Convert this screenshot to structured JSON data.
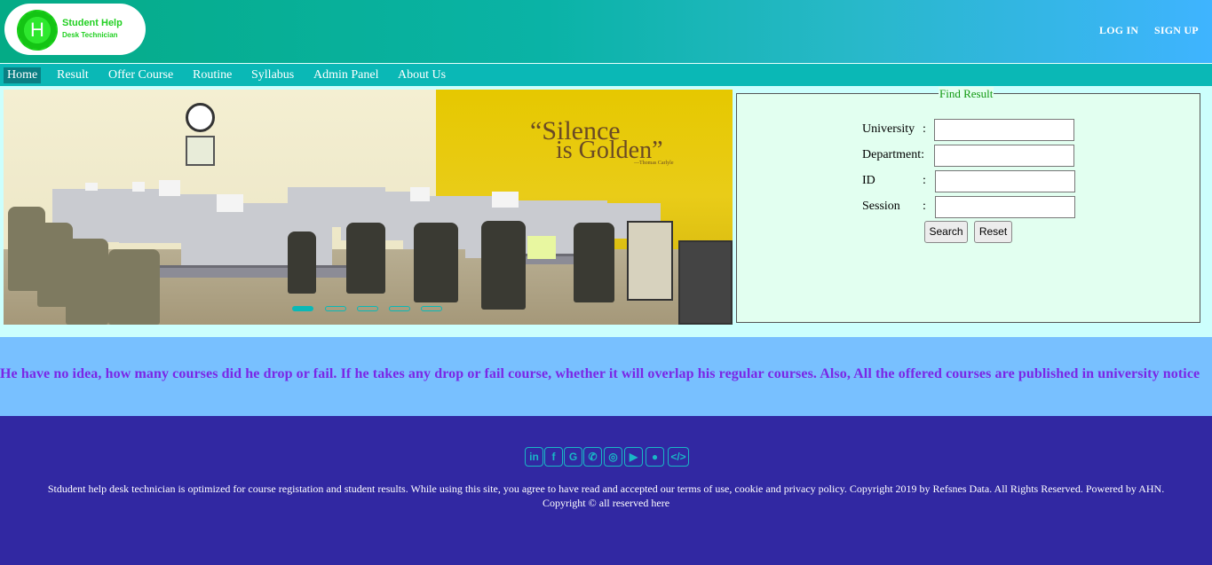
{
  "header": {
    "logo_letter": "H",
    "logo_line1": "Student Help",
    "logo_line2": "Desk Technician",
    "login_label": "LOG IN",
    "signup_label": "SIGN UP"
  },
  "nav": {
    "items": [
      {
        "label": "Home",
        "active": true
      },
      {
        "label": "Result"
      },
      {
        "label": "Offer Course"
      },
      {
        "label": "Routine"
      },
      {
        "label": "Syllabus"
      },
      {
        "label": "Admin Panel"
      },
      {
        "label": "About Us"
      }
    ]
  },
  "slider": {
    "quote_line1": "“Silence",
    "quote_line2": "is Golden”",
    "quote_author": "—Thomas Carlyle",
    "slide_count": 5,
    "active_slide": 1
  },
  "find_result": {
    "legend": "Find Result",
    "fields": [
      {
        "label": "University",
        "value": ""
      },
      {
        "label": "Department:",
        "value": ""
      },
      {
        "label": "ID",
        "value": ""
      },
      {
        "label": "Session",
        "value": ""
      }
    ],
    "search_label": "Search",
    "reset_label": "Reset"
  },
  "marquee": {
    "text": "He have no idea, how many courses did he drop or fail. If he takes any drop or fail course, whether it will overlap his regular courses. Also, All the offered courses are published in university notice"
  },
  "footer": {
    "social_icons": [
      "linkedin-icon",
      "facebook-icon",
      "google-icon",
      "whatsapp-icon",
      "instagram-icon",
      "youtube-icon",
      "github-icon",
      "code-icon"
    ],
    "text_line1": "Stdudent help desk technician is optimized for course registation and student results. While using this site, you agree to have read and accepted our terms of use, cookie and privacy policy. Copyright 2019 by Refsnes Data. All Rights Reserved. Powered by AHN.",
    "text_line2": "Copyright © all reserved here",
    "accent": "#19b7c6"
  }
}
